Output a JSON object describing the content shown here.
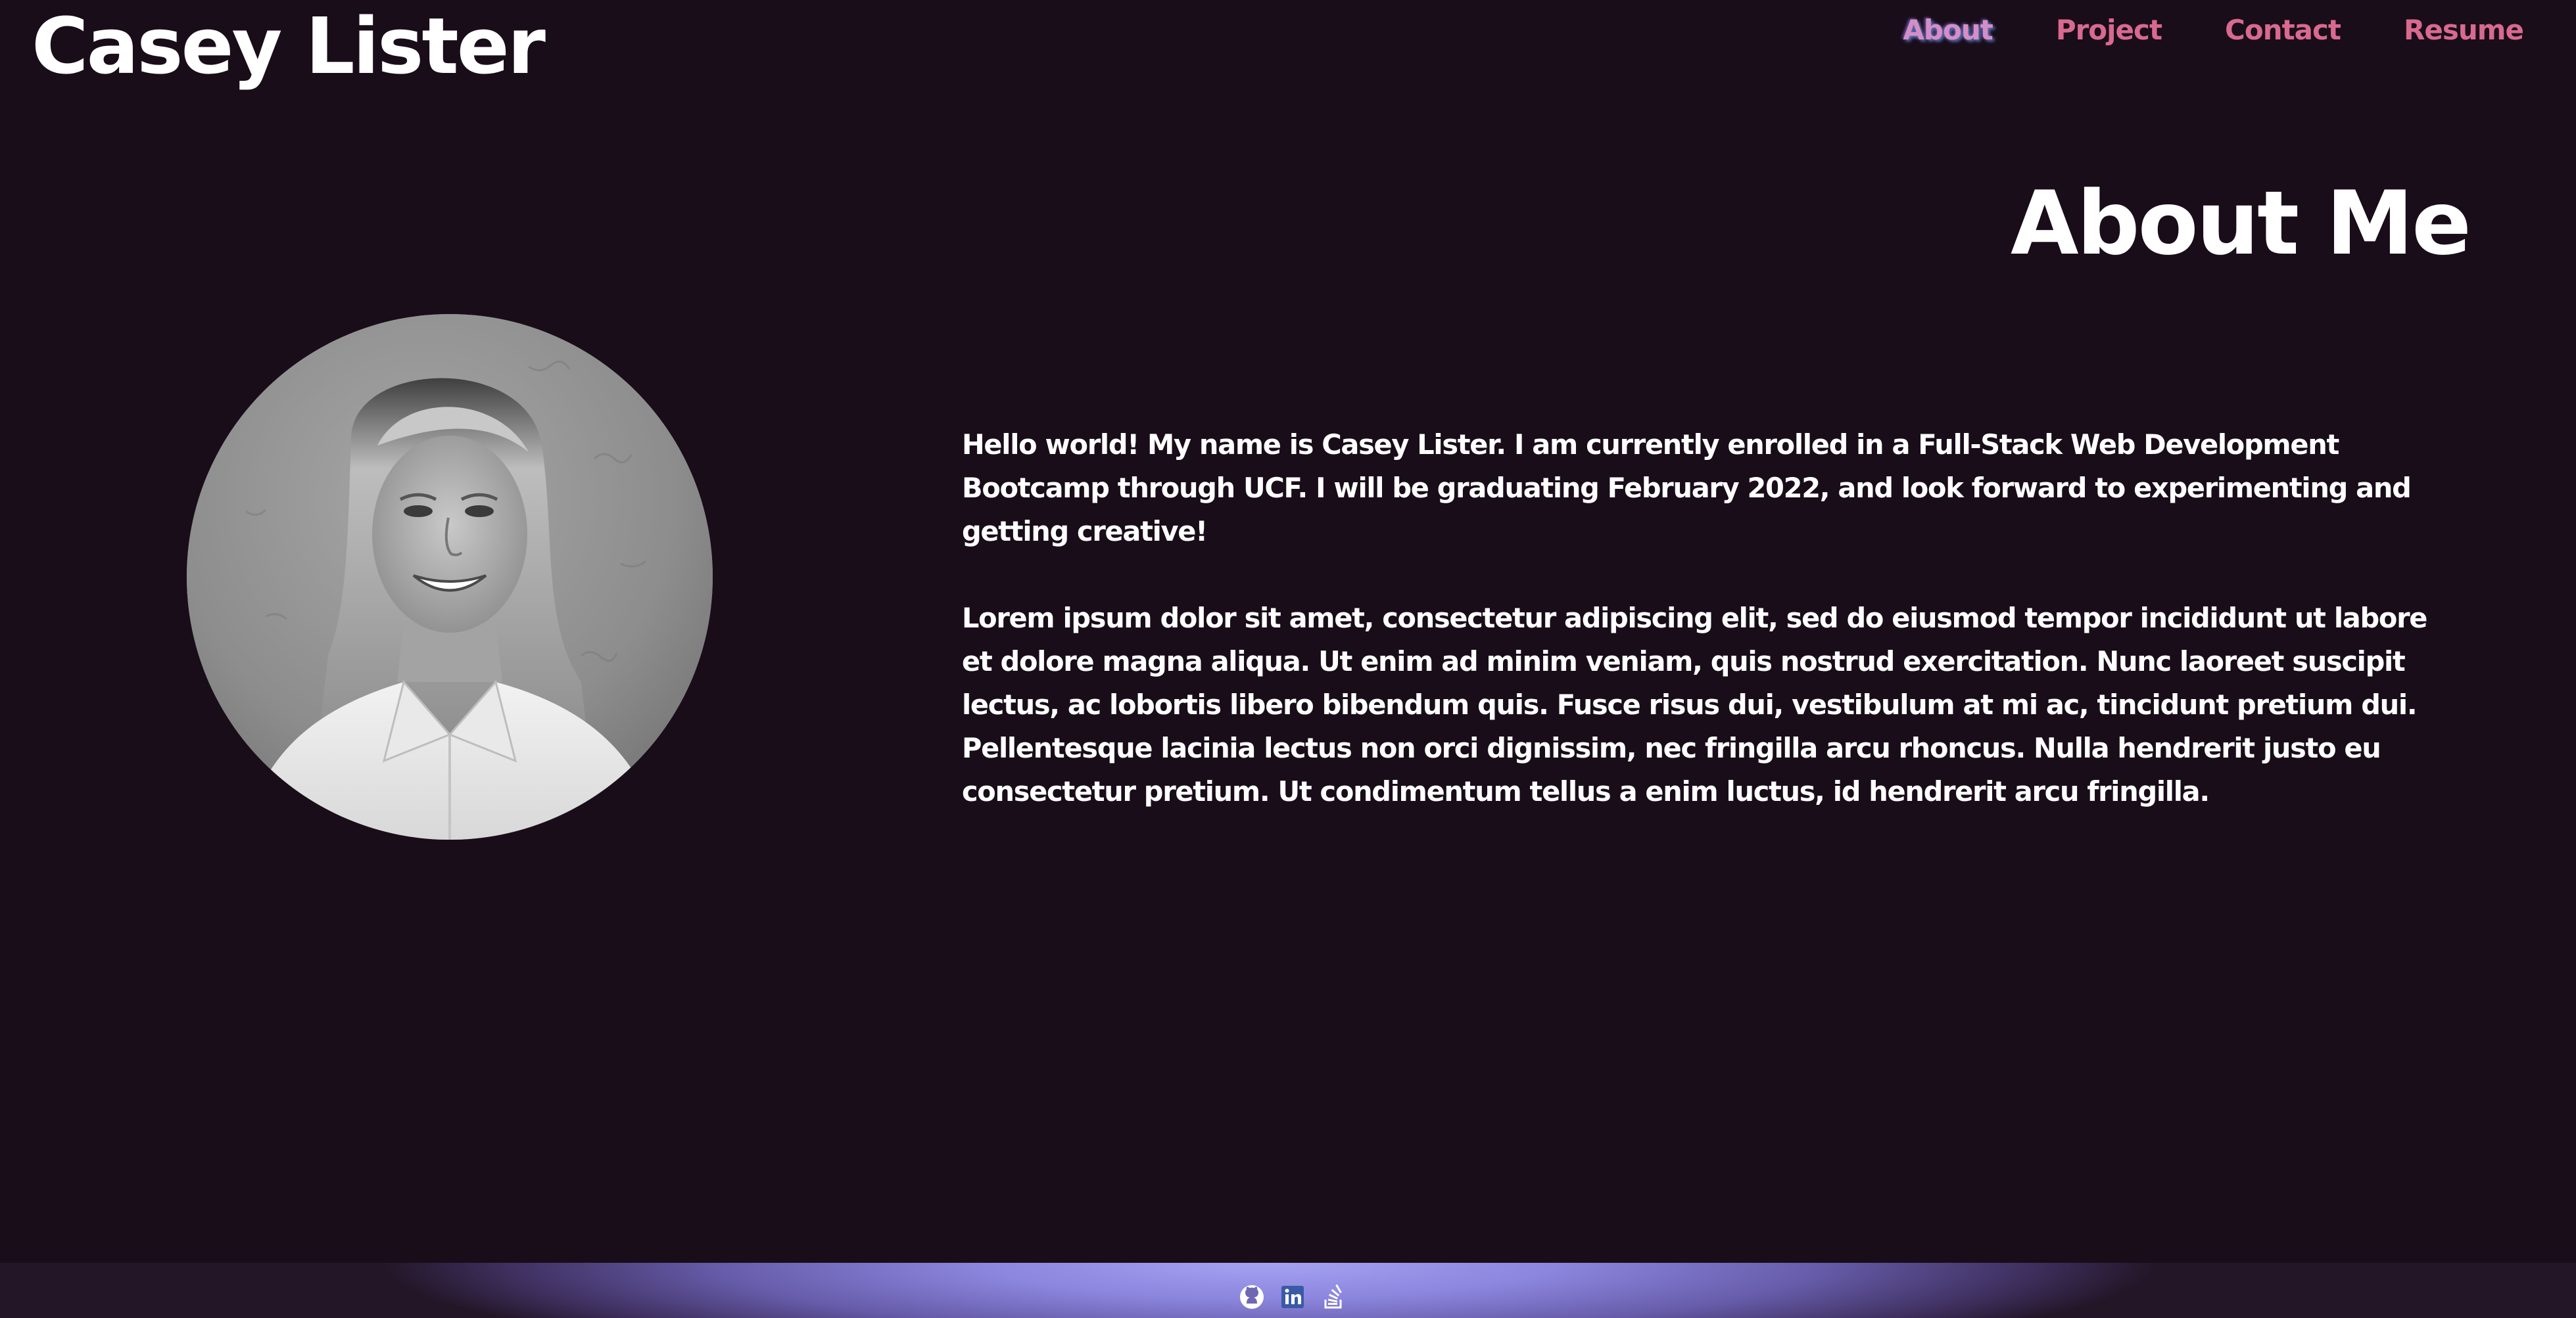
{
  "header": {
    "site_name": "Casey Lister",
    "nav": [
      {
        "label": "About"
      },
      {
        "label": "Project"
      },
      {
        "label": "Contact"
      },
      {
        "label": "Resume"
      }
    ]
  },
  "about": {
    "title": "About Me",
    "paragraphs": [
      "Hello world! My name is Casey Lister. I am currently enrolled in a Full-Stack Web Development Bootcamp through UCF. I will be graduating February 2022, and look forward to experimenting and getting creative!",
      "Lorem ipsum dolor sit amet, consectetur adipiscing elit, sed do eiusmod tempor incididunt ut labore et dolore magna aliqua. Ut enim ad minim veniam, quis nostrud exercitation. Nunc laoreet suscipit lectus, ac lobortis libero bibendum quis. Fusce risus dui, vestibulum at mi ac, tincidunt pretium dui. Pellentesque lacinia lectus non orci dignissim, nec fringilla arcu rhoncus. Nulla hendrerit justo eu consectetur pretium. Ut condimentum tellus a enim luctus, id hendrerit arcu fringilla."
    ]
  },
  "footer": {
    "socials": [
      {
        "icon": "github-icon"
      },
      {
        "icon": "linkedin-icon"
      },
      {
        "icon": "stackoverflow-icon"
      }
    ]
  },
  "colors": {
    "background": "#190d19",
    "nav_link": "#d8698f",
    "nav_active": "#d58ec5",
    "footer_glow": "#a5a2f2"
  }
}
